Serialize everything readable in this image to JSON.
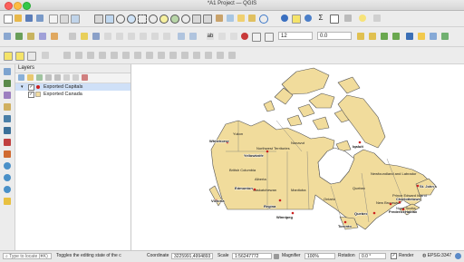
{
  "window": {
    "title": "*A1 Project — QGIS"
  },
  "toolbar2": {
    "scale_value": "12",
    "offset_value": "0.0"
  },
  "layers_panel": {
    "title": "Layers",
    "layers": [
      {
        "name": "Exported Capitals",
        "checked": true,
        "selected": true,
        "symbol_color": "#cc2020"
      },
      {
        "name": "Exported Canada",
        "checked": true,
        "selected": false,
        "symbol_color": "#f2dca0"
      }
    ]
  },
  "map": {
    "fill_color": "#f1dc9c",
    "stroke_color": "#555555",
    "province_labels": [
      "Yukon",
      "Northwest Territories",
      "Nunavut",
      "British Columbia",
      "Alberta",
      "Saskatchewan",
      "Manitoba",
      "Ontario",
      "Quebec",
      "Newfoundland and Labrador",
      "New Brunswick",
      "Nova Scotia",
      "Prince Edward Island"
    ],
    "capital_labels": [
      "Whitehorse",
      "Yellowknife",
      "Iqaluit",
      "Edmonton",
      "Regina",
      "Victoria",
      "Winnipeg",
      "Toronto",
      "Quebec",
      "St. John's",
      "Fredericton",
      "Charlottetown",
      "Halifax"
    ]
  },
  "statusbar": {
    "locate_placeholder": "Type to locate (⌘K)",
    "message": "Toggles the editing state of the c",
    "coordinate_label": "Coordinate",
    "coordinate_value": "3225991,4994893",
    "scale_label": "Scale",
    "scale_value": "1:56247772",
    "magnifier_label": "Magnifier",
    "magnifier_value": "100%",
    "rotation_label": "Rotation",
    "rotation_value": "0.0 °",
    "render_label": "Render",
    "crs_label": "EPSG:3347"
  }
}
